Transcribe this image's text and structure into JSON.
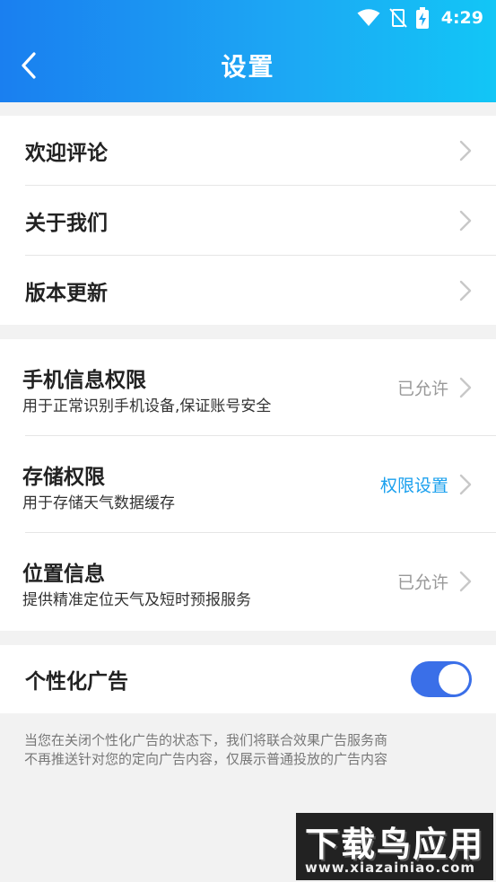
{
  "status_bar": {
    "time": "4:29"
  },
  "header": {
    "title": "设置"
  },
  "group1": {
    "items": [
      {
        "label": "欢迎评论"
      },
      {
        "label": "关于我们"
      },
      {
        "label": "版本更新"
      }
    ]
  },
  "permissions": {
    "items": [
      {
        "label": "手机信息权限",
        "desc": "用于正常识别手机设备,保证账号安全",
        "status": "已允许"
      },
      {
        "label": "存储权限",
        "desc": "用于存储天气数据缓存",
        "status": "权限设置"
      },
      {
        "label": "位置信息",
        "desc": "提供精准定位天气及短时预报服务",
        "status": "已允许"
      }
    ]
  },
  "ads": {
    "label": "个性化广告",
    "enabled": true
  },
  "footer": {
    "line1": "当您在关闭个性化广告的状态下，我们将联合效果广告服务商",
    "line2": "不再推送针对您的定向广告内容，仅展示普通投放的广告内容"
  },
  "watermark": {
    "title": "下载鸟应用",
    "url": "www.xiazainiao.com"
  },
  "colors": {
    "accent": "#1aa0ee",
    "toggle_on": "#3a6fe8"
  }
}
